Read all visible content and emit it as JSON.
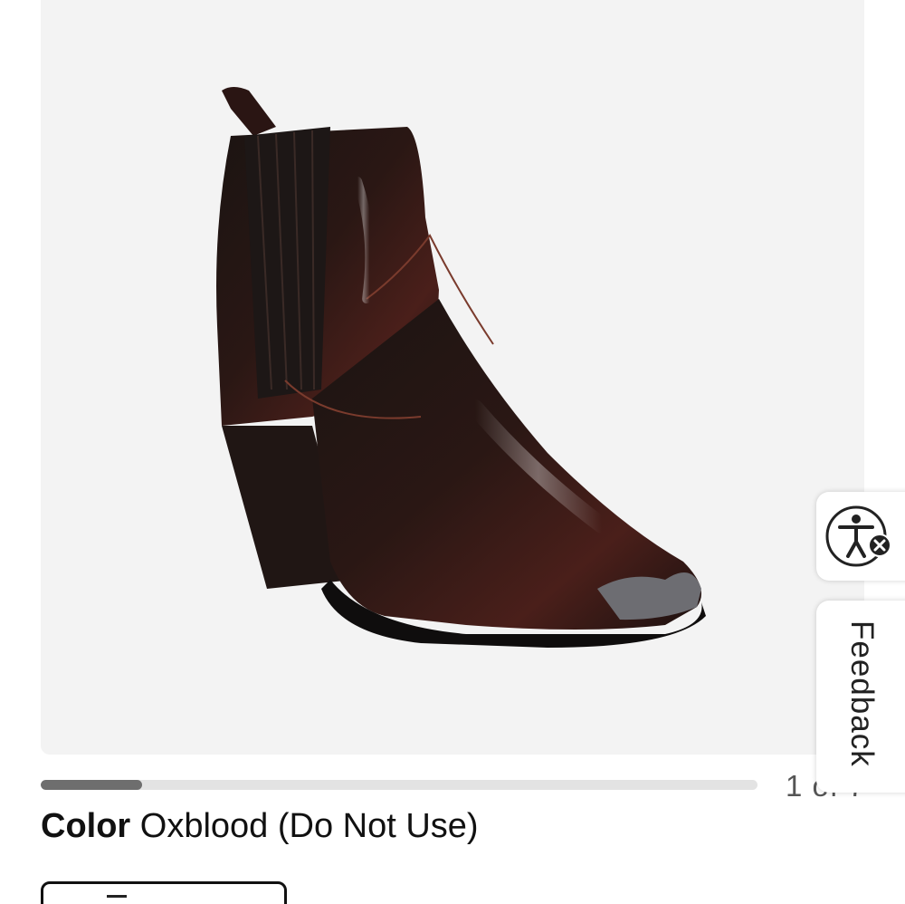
{
  "gallery": {
    "image_alt": "Oxblood leather western ankle boot with metal toe tip",
    "counter": "1 of 7",
    "progress": 0.142
  },
  "color": {
    "label": "Color",
    "value": "Oxblood (Do Not Use)"
  },
  "size_button": {
    "label": ""
  },
  "accessibility": {
    "icon": "accessibility-icon",
    "badge_icon": "close-icon"
  },
  "feedback": {
    "label": "Feedback"
  },
  "colors": {
    "image_bg": "#f3f3f3",
    "progress_track": "#e3e3e3",
    "progress_fill": "#6e6e6e",
    "text": "#111111"
  }
}
